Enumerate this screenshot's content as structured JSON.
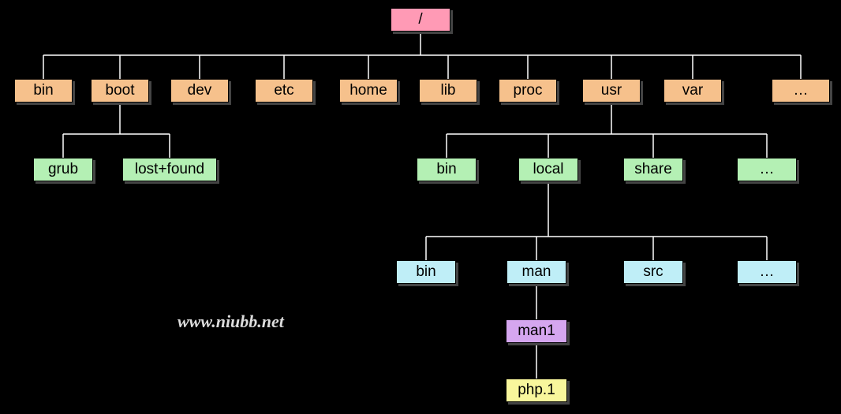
{
  "diagram": {
    "root": "/",
    "level1": [
      "bin",
      "boot",
      "dev",
      "etc",
      "home",
      "lib",
      "proc",
      "usr",
      "var",
      "…"
    ],
    "boot_children": [
      "grub",
      "lost+found"
    ],
    "usr_children": [
      "bin",
      "local",
      "share",
      "…"
    ],
    "local_children": [
      "bin",
      "man",
      "src",
      "…"
    ],
    "man_children": [
      "man1"
    ],
    "man1_children": [
      "php.1"
    ]
  },
  "watermark": "www.niubb.net",
  "colors": {
    "root": "#ff9ab5",
    "level1": "#f6c18c",
    "level2": "#b4f0b4",
    "level3": "#bfeef7",
    "level4": "#d5a6ef",
    "level5": "#f8f69c"
  }
}
